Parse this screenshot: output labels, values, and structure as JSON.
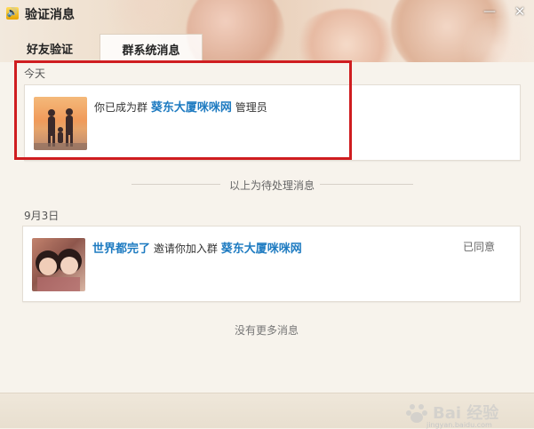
{
  "window": {
    "title": "验证消息",
    "icon": "speaker-icon",
    "minimize_label": "—",
    "close_label": "✕"
  },
  "tabs": [
    {
      "label": "好友验证",
      "active": false
    },
    {
      "label": "群系统消息",
      "active": true
    }
  ],
  "sections": {
    "today": {
      "date_label": "今天",
      "message": {
        "prefix": "你已成为群",
        "group_name": "葵东大厦咪咪网",
        "suffix": "管理员"
      }
    },
    "divider": {
      "text": "以上为待处理消息"
    },
    "sep3": {
      "date_label": "9月3日",
      "message": {
        "user_name": "世界都完了",
        "action": "邀请你加入群",
        "group_name": "葵东大厦咪咪网",
        "status": "已同意"
      }
    },
    "no_more": "没有更多消息"
  },
  "watermark": {
    "text": "Bai 经验",
    "url": "jingyan.baidu.com"
  },
  "colors": {
    "link": "#1e7bc1",
    "highlight_box": "#cf1d20"
  }
}
